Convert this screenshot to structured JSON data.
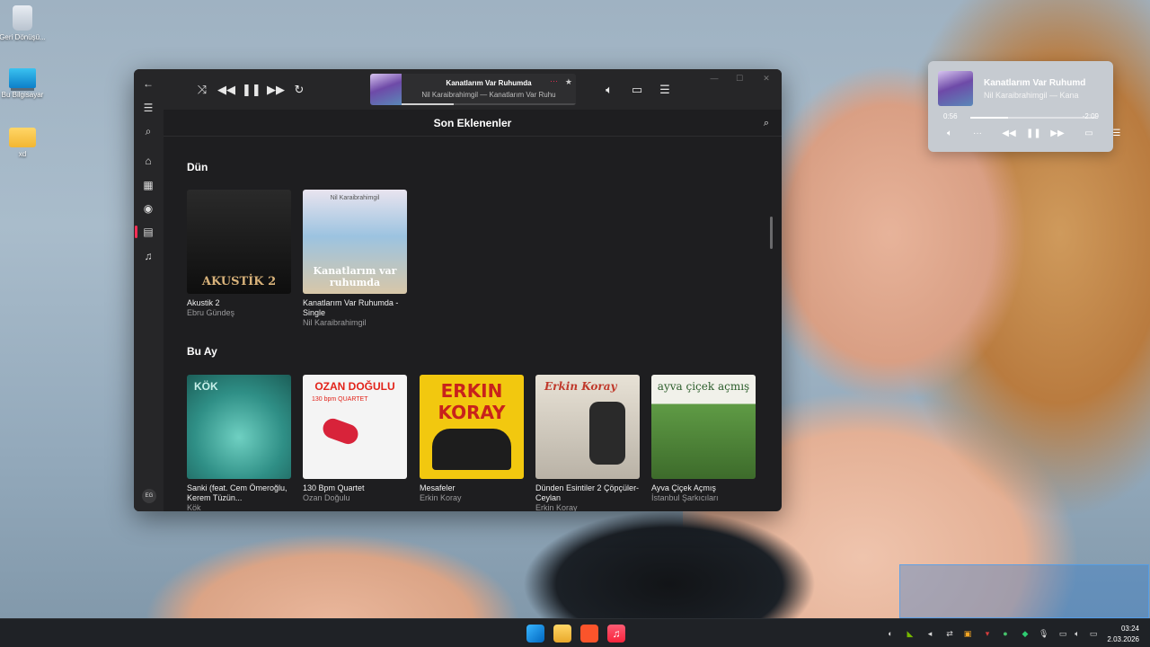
{
  "desktop": {
    "icons": [
      {
        "label": "Geri Dönüşü..."
      },
      {
        "label": "Bu Bilgisayar"
      },
      {
        "label": "xd"
      }
    ]
  },
  "music_app": {
    "now_playing": {
      "title": "Kanatlarım Var Ruhumda",
      "subtitle": "Nil Karaibrahimgil — Kanatlarım Var Ruhu",
      "progress": 0.3
    },
    "page_title": "Son Eklenenler",
    "sections": [
      {
        "title": "Dün",
        "albums": [
          {
            "title": "Akustik 2",
            "artist": "Ebru Gündeş",
            "cover_text": "AKUSTİK 2",
            "cover_color": "#1a1a1a"
          },
          {
            "title": "Kanatlarım Var Ruhumda - Single",
            "artist": "Nil Karaibrahimgil",
            "cover_text": "Kanatlarım var ruhumda",
            "cover_top": "Nil Karaibrahimgil",
            "cover_color": "#8fb7d8"
          }
        ]
      },
      {
        "title": "Bu Ay",
        "albums": [
          {
            "title": "Sanki (feat. Cem Ömeroğlu, Kerem Tüzün...",
            "artist": "Kök",
            "cover_top": "KÖK",
            "cover_color": "#2f8f86"
          },
          {
            "title": "130 Bpm Quartet",
            "artist": "Ozan Doğulu",
            "cover_top": "OZAN DOĞULU",
            "cover_sub": "130 bpm QUARTET",
            "cover_color": "#f2f2f2"
          },
          {
            "title": "Mesafeler",
            "artist": "Erkin Koray",
            "cover_top": "ERKIN KORAY",
            "cover_color": "#f2c80f"
          },
          {
            "title": "Dünden Esintiler 2 Çöpçüler-Ceylan",
            "artist": "Erkin Koray",
            "cover_top": "Erkin Koray",
            "cover_color": "#c9c3b8"
          },
          {
            "title": "Ayva Çiçek Açmış",
            "artist": "İstanbul Şarkıcıları",
            "cover_top": "ayva çiçek açmış",
            "cover_color": "#6fa24a"
          }
        ]
      }
    ],
    "avatar_initials": "EG"
  },
  "mini_player": {
    "title": "Kanatlarım Var Ruhumd",
    "subtitle": "Nil Karaibrahimgil — Kana",
    "elapsed": "0:56",
    "remaining": "-2:09",
    "progress": 0.3
  },
  "taskbar": {
    "time": "03:24",
    "date": "2.03.2026"
  }
}
